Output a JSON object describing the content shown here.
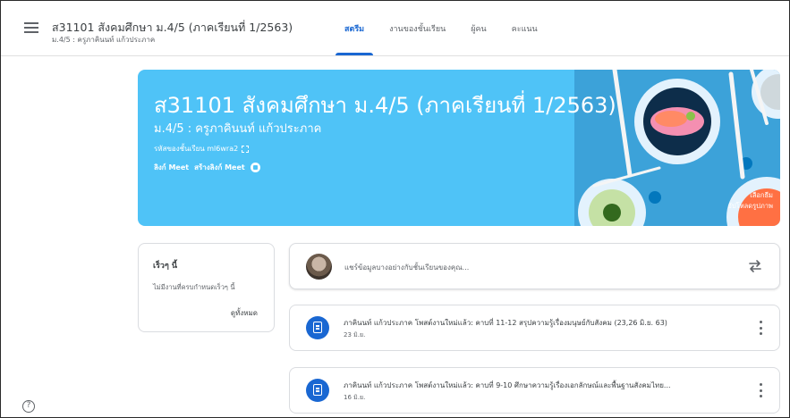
{
  "header": {
    "class_title": "ส31101 สังคมศึกษา ม.4/5 (ภาคเรียนที่ 1/2563)",
    "class_subtitle": "ม.4/5 : ครูภาคินนท์ แก้วประภาค",
    "tabs": [
      {
        "label": "สตรีม",
        "active": true
      },
      {
        "label": "งานของชั้นเรียน",
        "active": false
      },
      {
        "label": "ผู้คน",
        "active": false
      },
      {
        "label": "คะแนน",
        "active": false
      }
    ]
  },
  "banner": {
    "title": "ส31101 สังคมศึกษา ม.4/5 (ภาคเรียนที่ 1/2563)",
    "subtitle": "ม.4/5 : ครูภาคินนท์ แก้วประภาค",
    "class_code": "รหัสของชั้นเรียน ml6wra2",
    "meet_label": "ลิงก์ Meet",
    "create_meet_label": "สร้างลิงก์ Meet",
    "select_theme": "เลือกธีม",
    "upload_photo": "อัปโหลดรูปภาพ",
    "color": "#4fc3f7"
  },
  "upcoming": {
    "title": "เร็วๆ นี้",
    "text": "ไม่มีงานที่ครบกำหนดเร็วๆ นี้",
    "view_all": "ดูทั้งหมด"
  },
  "share": {
    "placeholder": "แชร์ข้อมูลบางอย่างกับชั้นเรียนของคุณ..."
  },
  "posts": [
    {
      "title": "ภาคินนท์ แก้วประภาค โพสต์งานใหม่แล้ว: คาบที่ 11-12 สรุปความรู้เรื่องมนุษย์กับสังคม (23,26 มิ.ย. 63)",
      "date": "23 มิ.ย."
    },
    {
      "title": "ภาคินนท์ แก้วประภาค โพสต์งานใหม่แล้ว: คาบที่ 9-10 ศึกษาความรู้เรื่องเอกลักษณ์และพื้นฐานสังคมไทย...",
      "date": "16 มิ.ย."
    }
  ],
  "colors": {
    "accent": "#1967d2",
    "banner": "#4fc3f7"
  }
}
